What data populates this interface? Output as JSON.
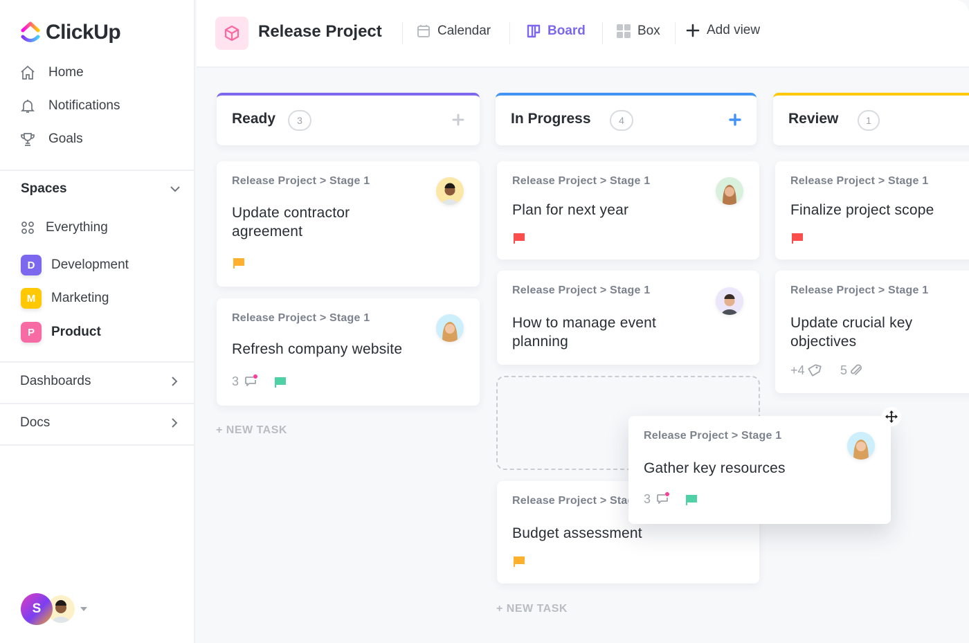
{
  "app": {
    "name": "ClickUp"
  },
  "sidebar": {
    "nav": [
      {
        "label": "Home",
        "icon": "home-icon"
      },
      {
        "label": "Notifications",
        "icon": "bell-icon"
      },
      {
        "label": "Goals",
        "icon": "trophy-icon"
      }
    ],
    "spaces_label": "Spaces",
    "everything_label": "Everything",
    "spaces": [
      {
        "letter": "D",
        "label": "Development",
        "color": "#7b68ee"
      },
      {
        "letter": "M",
        "label": "Marketing",
        "color": "#ffc800"
      },
      {
        "letter": "P",
        "label": "Product",
        "color": "#f76aa3",
        "active": true
      }
    ],
    "dashboards_label": "Dashboards",
    "docs_label": "Docs",
    "user_initial": "S"
  },
  "header": {
    "project_title": "Release Project",
    "views": [
      {
        "label": "Calendar",
        "icon": "calendar-icon"
      },
      {
        "label": "Board",
        "icon": "board-icon",
        "active": true
      },
      {
        "label": "Box",
        "icon": "box-grid-icon"
      }
    ],
    "add_view_label": "Add view"
  },
  "board": {
    "new_task_label": "+ NEW TASK",
    "columns": [
      {
        "title": "Ready",
        "count": "3",
        "color": "#7b68ee",
        "tasks": [
          {
            "path": "Release Project > Stage 1",
            "title": "Update contractor agreement",
            "flag": "#ffb02e"
          },
          {
            "path": "Release Project > Stage 1",
            "title": "Refresh company website",
            "comments": "3",
            "flag": "#4fd1a5"
          }
        ]
      },
      {
        "title": "In Progress",
        "count": "4",
        "color": "#4194f6",
        "tasks": [
          {
            "path": "Release Project > Stage 1",
            "title": "Plan for next year",
            "flag": "#fd4e4e"
          },
          {
            "path": "Release Project > Stage 1",
            "title": "How to manage event planning"
          },
          {
            "path": "Release Project > Stage 1",
            "title": "Budget assessment",
            "flag": "#ffb02e"
          }
        ]
      },
      {
        "title": "Review",
        "count": "1",
        "color": "#ffc800",
        "tasks": [
          {
            "path": "Release Project > Stage 1",
            "title": "Finalize project scope",
            "flag": "#fd4e4e"
          },
          {
            "path": "Release Project > Stage 1",
            "title": "Update crucial key objectives",
            "tags": "+4",
            "attachments": "5"
          }
        ]
      }
    ],
    "dragging_task": {
      "path": "Release Project > Stage 1",
      "title": "Gather key resources",
      "comments": "3",
      "flag": "#4fd1a5"
    }
  }
}
